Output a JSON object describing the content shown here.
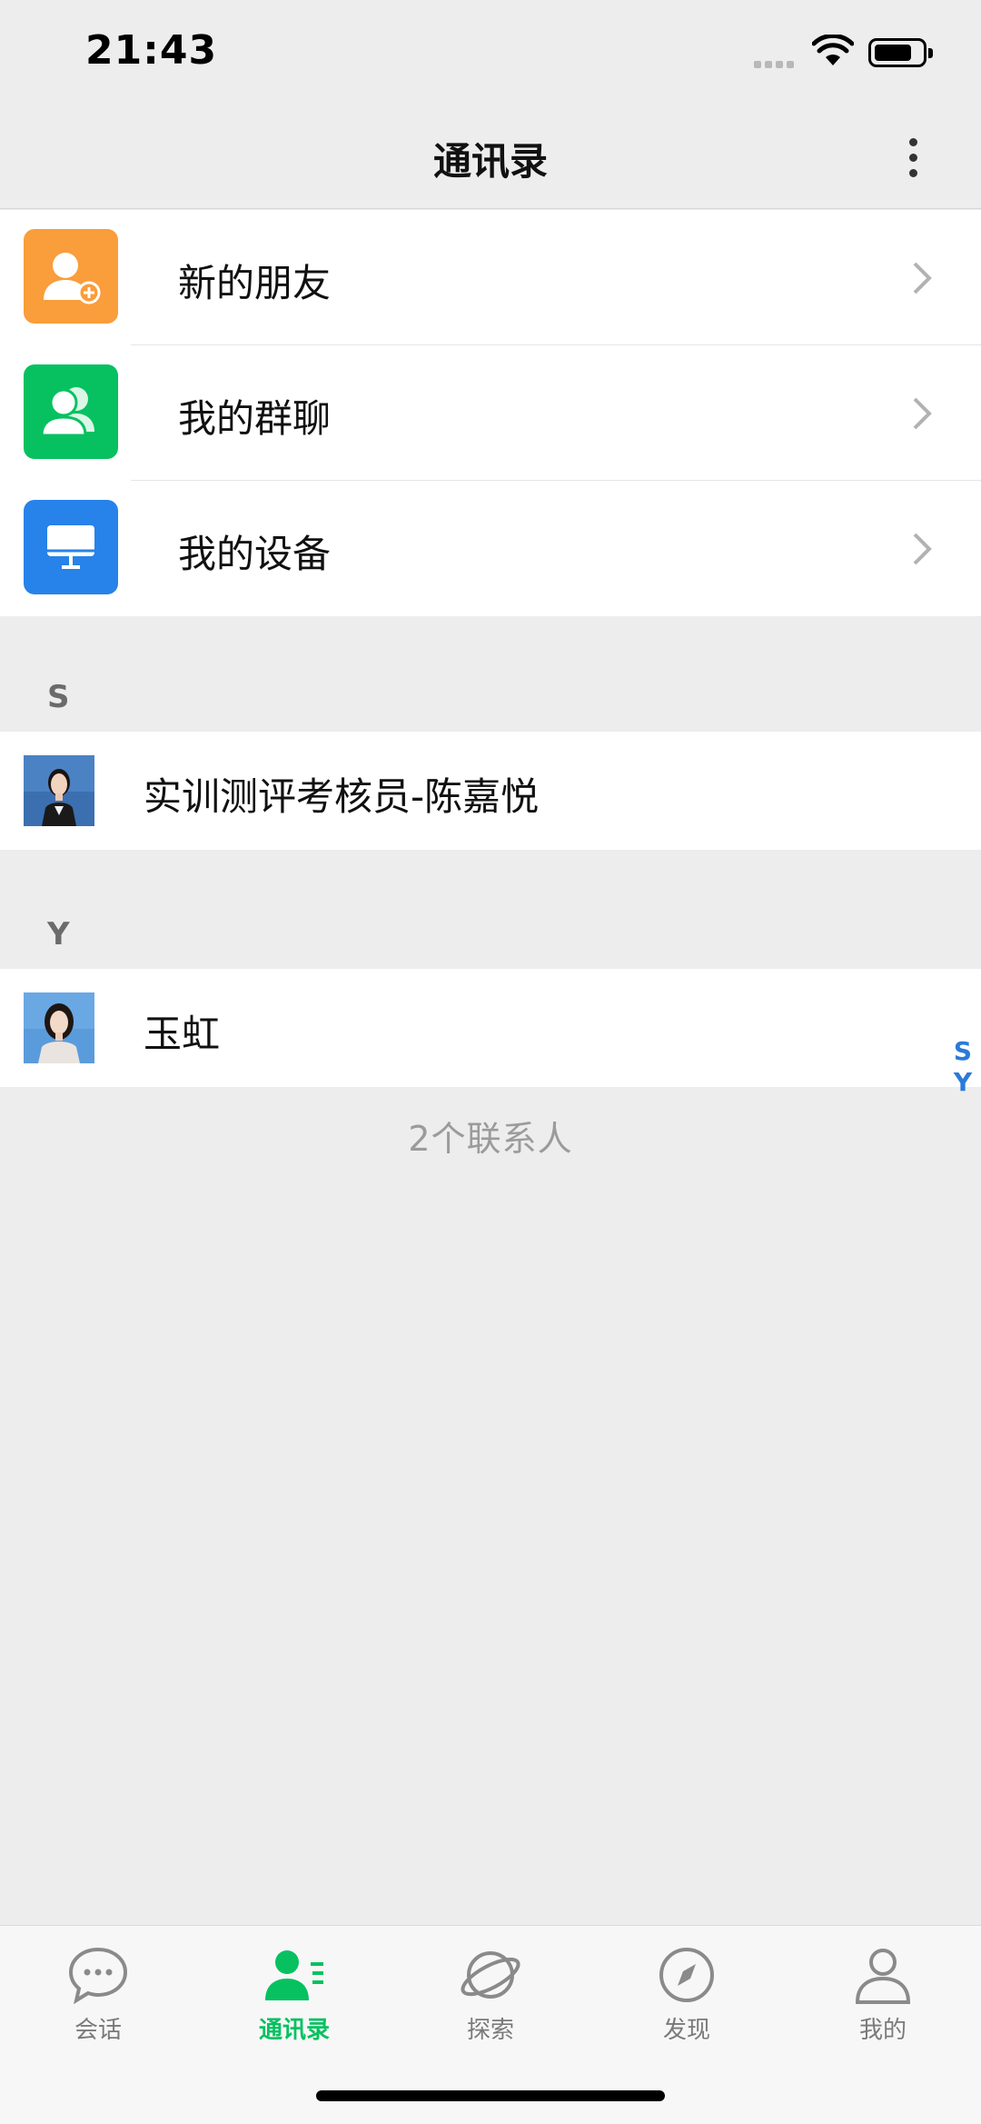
{
  "status_bar": {
    "time": "21:43"
  },
  "nav": {
    "title": "通讯录"
  },
  "menu": [
    {
      "label": "新的朋友",
      "icon": "add-friend-icon",
      "color": "#fa9d3b"
    },
    {
      "label": "我的群聊",
      "icon": "group-chat-icon",
      "color": "#07c160"
    },
    {
      "label": "我的设备",
      "icon": "device-icon",
      "color": "#2782ea"
    }
  ],
  "sections": [
    {
      "letter": "S",
      "contacts": [
        {
          "name": "实训测评考核员-陈嘉悦"
        }
      ]
    },
    {
      "letter": "Y",
      "contacts": [
        {
          "name": "玉虹"
        }
      ]
    }
  ],
  "index_bar": [
    "S",
    "Y"
  ],
  "contact_count": "2个联系人",
  "tabs": [
    {
      "label": "会话",
      "icon": "chat-bubble-icon",
      "active": false
    },
    {
      "label": "通讯录",
      "icon": "contacts-icon",
      "active": true
    },
    {
      "label": "探索",
      "icon": "planet-icon",
      "active": false
    },
    {
      "label": "发现",
      "icon": "compass-icon",
      "active": false
    },
    {
      "label": "我的",
      "icon": "person-icon",
      "active": false
    }
  ],
  "colors": {
    "accent": "#07c160",
    "index": "#2a7ad9",
    "background": "#ededed"
  }
}
